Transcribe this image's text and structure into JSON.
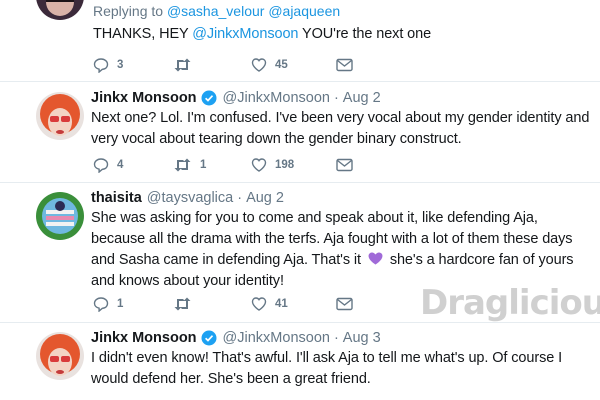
{
  "top_tweet": {
    "reply_prefix": "Replying to",
    "reply_to": "@sasha_velour @ajaqueen",
    "text_before": "THANKS, HEY ",
    "mention": "@JinkxMonsoon",
    "text_after": " YOU're the next one",
    "replies": "3",
    "retweets": "",
    "likes": "45"
  },
  "tweet1": {
    "name": "Jinkx Monsoon",
    "handle": "@JinkxMonsoon",
    "date": "Aug 2",
    "text": "Next one? Lol. I'm confused. I've been very vocal about my gender identity and very vocal about tearing down the gender binary construct.",
    "replies": "4",
    "retweets": "1",
    "likes": "198"
  },
  "tweet2": {
    "name": "thaisita",
    "handle": "@taysvaglica",
    "date": "Aug 2",
    "text_before": "She was asking for you to come and speak about it, like defending Aja, because all the drama with the terfs. Aja fought with a lot of them these days and Sasha came in defending Aja. That's it ",
    "text_after": " she's a hardcore fan of yours and knows about your identity!",
    "replies": "1",
    "retweets": "",
    "likes": "41"
  },
  "tweet3": {
    "name": "Jinkx Monsoon",
    "handle": "@JinkxMonsoon",
    "date": "Aug 3",
    "text": "I didn't even know! That's awful. I'll ask Aja to tell me what's up. Of course I would defend her. She's been a great friend."
  },
  "separator": "·",
  "watermark": "Draglicious",
  "icons": {
    "reply": "reply-icon",
    "retweet": "retweet-icon",
    "like": "heart-icon",
    "dm": "envelope-icon",
    "verified": "verified-badge-icon",
    "emoji": "purple-heart-emoji"
  },
  "colors": {
    "link": "#1b95e0",
    "muted": "#657786",
    "verified": "#1da1f2",
    "purple_heart": "#a06ad8"
  }
}
